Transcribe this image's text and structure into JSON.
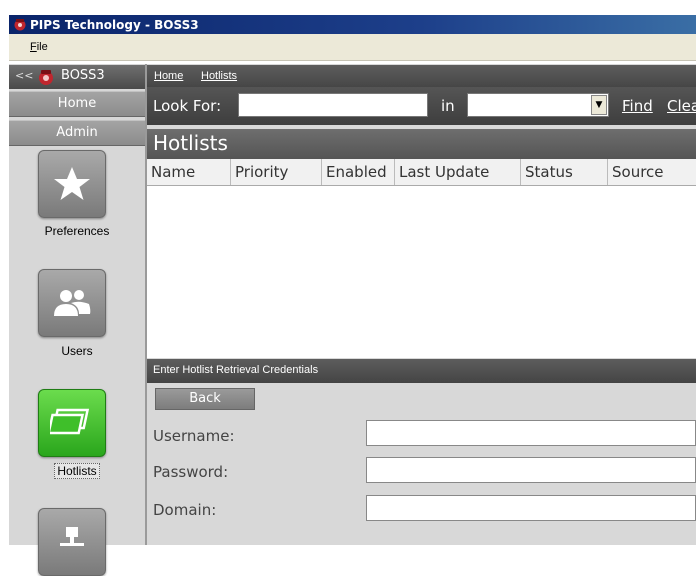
{
  "window": {
    "title": "PIPS Technology - BOSS3",
    "icon": "boss3-logo-icon"
  },
  "menubar": {
    "file_label": "File",
    "file_mnemonic": "F"
  },
  "sidebar": {
    "collapse_label": "<<",
    "title": "BOSS3",
    "home_label": "Home",
    "admin_label": "Admin",
    "items": [
      {
        "label": "Preferences",
        "icon": "star-icon",
        "active": false
      },
      {
        "label": "Users",
        "icon": "users-icon",
        "active": false
      },
      {
        "label": "Hotlists",
        "icon": "hotlists-icon",
        "active": true
      },
      {
        "label": "",
        "icon": "network-icon",
        "active": false
      }
    ]
  },
  "breadcrumb": {
    "items": [
      "Home",
      "Hotlists"
    ]
  },
  "search": {
    "look_for_label": "Look For:",
    "look_for_value": "",
    "in_label": "in",
    "in_selected": "",
    "find_label": "Find",
    "clear_label": "Clea"
  },
  "section": {
    "title": "Hotlists"
  },
  "table": {
    "columns": [
      "Name",
      "Priority",
      "Enabled",
      "Last Update",
      "Status",
      "Source"
    ],
    "rows": []
  },
  "credentials": {
    "header": "Enter Hotlist Retrieval Credentials",
    "back_label": "Back",
    "username_label": "Username:",
    "username_value": "",
    "password_label": "Password:",
    "password_value": "",
    "domain_label": "Domain:",
    "domain_value": ""
  },
  "colors": {
    "title_bar": "#0a246a",
    "active_tile": "#2aa61c",
    "inactive_tile": "#7a7a7a",
    "panel_header": "#4a4a4a"
  }
}
